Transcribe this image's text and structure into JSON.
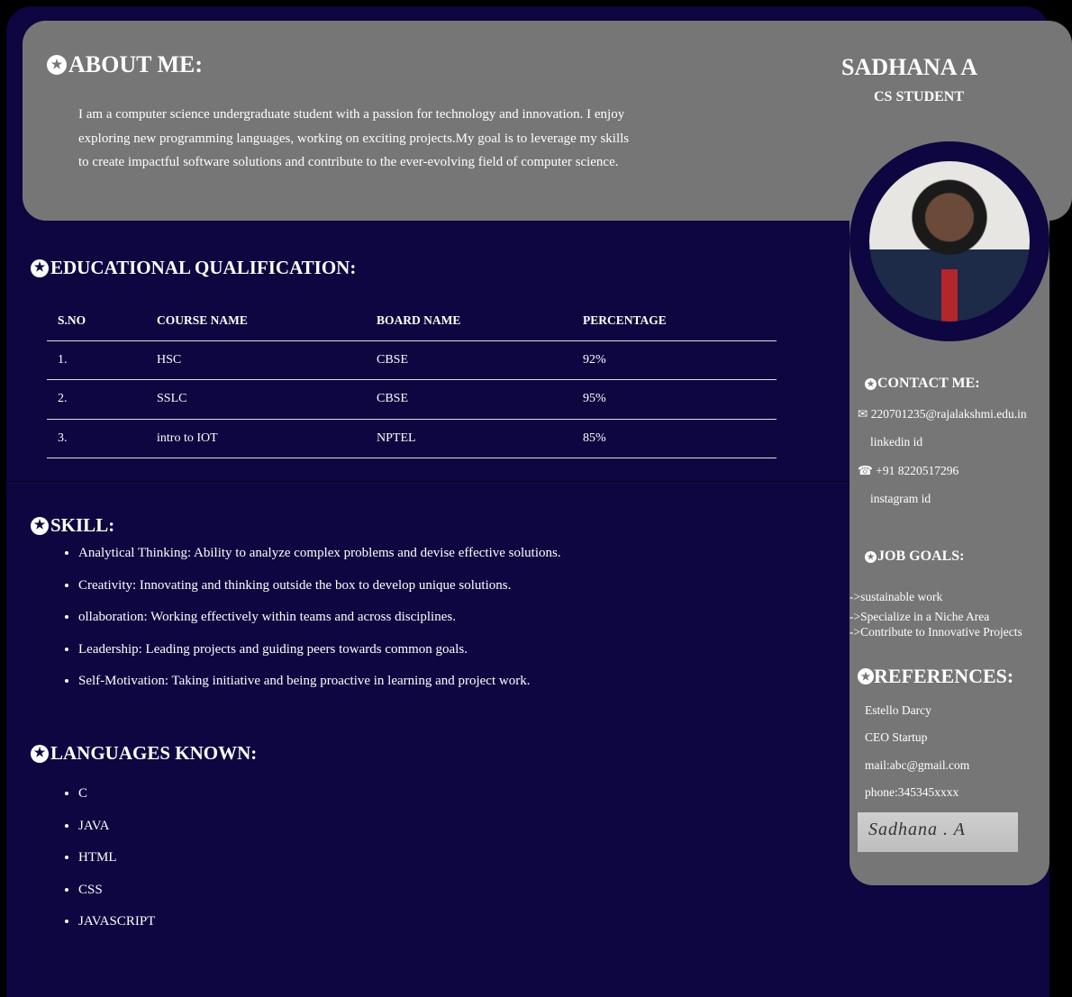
{
  "about": {
    "title": "ABOUT ME:",
    "text": "I am a computer science undergraduate student with a passion for technology and innovation. I enjoy exploring new programming languages, working on exciting projects.My goal is to leverage my skills to create impactful software solutions and contribute to the ever-evolving field of computer science."
  },
  "profile": {
    "name": "SADHANA A",
    "role": "CS STUDENT"
  },
  "contact": {
    "title": "CONTACT ME:",
    "email": "220701235@rajalakshmi.edu.in",
    "linkedin": "linkedin id",
    "phone": "+91 8220517296",
    "instagram": "instagram id"
  },
  "job_goals": {
    "title": "JOB GOALS:",
    "items": [
      "->sustainable work",
      "->Specialize in a Niche Area",
      "->Contribute to Innovative Projects"
    ]
  },
  "references": {
    "title": "REFERENCES:",
    "name": "Estello Darcy",
    "position": "CEO Startup",
    "mail": "mail:abc@gmail.com",
    "phone": "phone:345345xxxx",
    "signature": "Sadhana . A"
  },
  "education": {
    "title": "EDUCATIONAL QUALIFICATION:",
    "headers": [
      "S.NO",
      "COURSE NAME",
      "BOARD NAME",
      "PERCENTAGE"
    ],
    "rows": [
      [
        "1.",
        "HSC",
        "CBSE",
        "92%"
      ],
      [
        "2.",
        "SSLC",
        "CBSE",
        "95%"
      ],
      [
        "3.",
        "intro to IOT",
        "NPTEL",
        "85%"
      ]
    ]
  },
  "skills": {
    "title": "SKILL:",
    "items": [
      "Analytical Thinking: Ability to analyze complex problems and devise effective solutions.",
      "Creativity: Innovating and thinking outside the box to develop unique solutions.",
      "ollaboration: Working effectively within teams and across disciplines.",
      "Leadership: Leading projects and guiding peers towards common goals.",
      "Self-Motivation: Taking initiative and being proactive in learning and project work."
    ]
  },
  "languages": {
    "title": "LANGUAGES KNOWN:",
    "items": [
      "C",
      "JAVA",
      "HTML",
      "CSS",
      "JAVASCRIPT"
    ]
  },
  "colors": {
    "background": "#0d0640",
    "panel": "#767676"
  }
}
